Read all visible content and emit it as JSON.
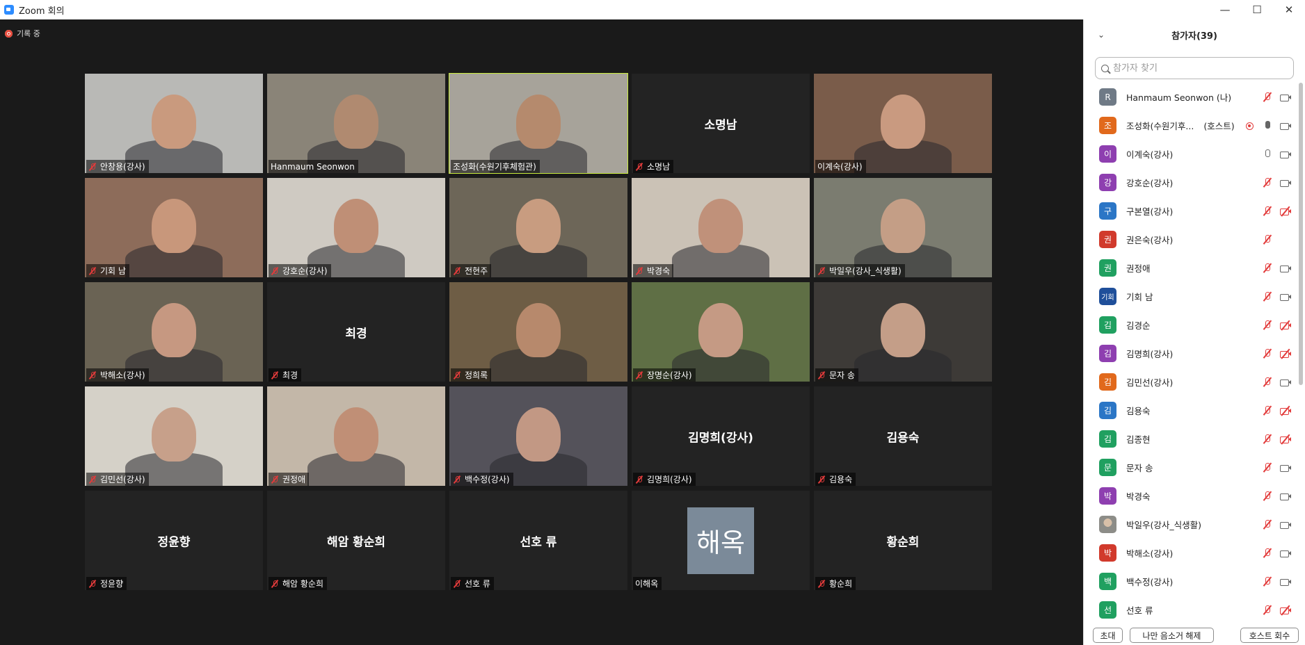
{
  "window": {
    "title": "Zoom 회의",
    "minimize": "—",
    "maximize": "☐",
    "close": "✕"
  },
  "recording": {
    "label": "기록 중"
  },
  "tiles": [
    {
      "name": "안창용(강사)",
      "kind": "video",
      "muted": true,
      "bg": "#b9b9b6",
      "skin": "#c99a7e"
    },
    {
      "name": "Hanmaum Seonwon",
      "kind": "video",
      "muted": false,
      "bg": "#8a8478",
      "skin": "#b08a70"
    },
    {
      "name": "조성화(수원기후체험관)",
      "kind": "video",
      "muted": false,
      "active": true,
      "bg": "#a7a39a",
      "skin": "#b58a6d"
    },
    {
      "name": "소명남",
      "kind": "name",
      "muted": true
    },
    {
      "name": "이계숙(강사)",
      "kind": "video",
      "muted": false,
      "bg": "#7a5c4a",
      "skin": "#c99a80"
    },
    {
      "name": "기회 남",
      "kind": "video",
      "muted": true,
      "bg": "#8d6c5a",
      "skin": "#c8977b"
    },
    {
      "name": "강호순(강사)",
      "kind": "video",
      "muted": true,
      "bg": "#cfcac2",
      "skin": "#bf8f76"
    },
    {
      "name": "전현주",
      "kind": "video",
      "muted": true,
      "bg": "#6d6658",
      "skin": "#c89c80"
    },
    {
      "name": "박경숙",
      "kind": "video",
      "muted": true,
      "bg": "#cbc2b6",
      "skin": "#c0917a"
    },
    {
      "name": "박일우(강사_식생활)",
      "kind": "video",
      "muted": true,
      "bg": "#7b7c70",
      "skin": "#c49e86"
    },
    {
      "name": "박해소(강사)",
      "kind": "video",
      "muted": true,
      "bg": "#6a6354",
      "skin": "#c69881"
    },
    {
      "name": "최경",
      "kind": "name",
      "muted": true
    },
    {
      "name": "정희록",
      "kind": "video",
      "muted": true,
      "bg": "#6e5d45",
      "skin": "#b7896c"
    },
    {
      "name": "장명순(강사)",
      "kind": "video",
      "muted": true,
      "bg": "#5f6f45",
      "skin": "#c59a84"
    },
    {
      "name": "문자 송",
      "kind": "video",
      "muted": true,
      "bg": "#3d3a37",
      "skin": "#c49e88"
    },
    {
      "name": "김민선(강사)",
      "kind": "video",
      "muted": true,
      "bg": "#d5d1c8",
      "skin": "#c7a08a"
    },
    {
      "name": "권정애",
      "kind": "video",
      "muted": true,
      "bg": "#c3b7a8",
      "skin": "#c08f76"
    },
    {
      "name": "백수정(강사)",
      "kind": "video",
      "muted": true,
      "bg": "#54525a",
      "skin": "#c29884"
    },
    {
      "name": "김명희(강사)",
      "kind": "name",
      "muted": true
    },
    {
      "name": "김용숙",
      "kind": "name",
      "muted": true
    },
    {
      "name": "정윤향",
      "kind": "name",
      "muted": true
    },
    {
      "name": "해암 황순희",
      "kind": "name",
      "muted": true
    },
    {
      "name": "선호 류",
      "kind": "name",
      "muted": true
    },
    {
      "name": "이해옥",
      "kind": "avatar",
      "avatar_text": "해옥",
      "muted": false
    },
    {
      "name": "황순희",
      "kind": "name",
      "muted": true
    }
  ],
  "panel": {
    "title": "참가자(39)",
    "search_placeholder": "참가자 찾기",
    "participants": [
      {
        "initial": "R",
        "color": "#6f7a86",
        "name": "Hanmaum Seonwon (나)",
        "mic": "off",
        "cam": "on"
      },
      {
        "initial": "조",
        "color": "#e1691c",
        "name": "조성화(수원기후...",
        "role": "(호스트)",
        "rec": true,
        "mic": "on-filled",
        "cam": "on"
      },
      {
        "initial": "이",
        "color": "#8e3fb0",
        "name": "이계숙(강사)",
        "mic": "on",
        "cam": "on"
      },
      {
        "initial": "강",
        "color": "#8e3fb0",
        "name": "강호순(강사)",
        "mic": "off",
        "cam": "on"
      },
      {
        "initial": "구",
        "color": "#2b76c6",
        "name": "구본열(강사)",
        "mic": "off",
        "cam": "off"
      },
      {
        "initial": "권",
        "color": "#d13a2c",
        "name": "권은숙(강사)",
        "mic": "off",
        "cam": "none"
      },
      {
        "initial": "권",
        "color": "#20a060",
        "name": "권정애",
        "mic": "off",
        "cam": "on"
      },
      {
        "initial": "기회",
        "color": "#1f4f9a",
        "name": "기회 남",
        "mic": "off",
        "cam": "on"
      },
      {
        "initial": "김",
        "color": "#20a060",
        "name": "김경순",
        "mic": "off",
        "cam": "off"
      },
      {
        "initial": "김",
        "color": "#8e3fb0",
        "name": "김명희(강사)",
        "mic": "off",
        "cam": "off"
      },
      {
        "initial": "김",
        "color": "#e1691c",
        "name": "김민선(강사)",
        "mic": "off",
        "cam": "on"
      },
      {
        "initial": "김",
        "color": "#2b76c6",
        "name": "김용숙",
        "mic": "off",
        "cam": "off"
      },
      {
        "initial": "김",
        "color": "#20a060",
        "name": "김종현",
        "mic": "off",
        "cam": "off"
      },
      {
        "initial": "문",
        "color": "#20a060",
        "name": "문자 송",
        "mic": "off",
        "cam": "on"
      },
      {
        "initial": "박",
        "color": "#8e3fb0",
        "name": "박경숙",
        "mic": "off",
        "cam": "on"
      },
      {
        "initial": "",
        "color": "#a8a8a0",
        "name": "박일우(강사_식생활)",
        "mic": "off",
        "cam": "on",
        "photo": true
      },
      {
        "initial": "박",
        "color": "#d13a2c",
        "name": "박해소(강사)",
        "mic": "off",
        "cam": "on"
      },
      {
        "initial": "백",
        "color": "#20a060",
        "name": "백수정(강사)",
        "mic": "off",
        "cam": "on"
      },
      {
        "initial": "선",
        "color": "#20a060",
        "name": "선호 류",
        "mic": "off",
        "cam": "off"
      }
    ],
    "footer": {
      "invite": "초대",
      "unmute_me": "나만 음소거 해제",
      "reclaim_host": "호스트 회수"
    }
  }
}
